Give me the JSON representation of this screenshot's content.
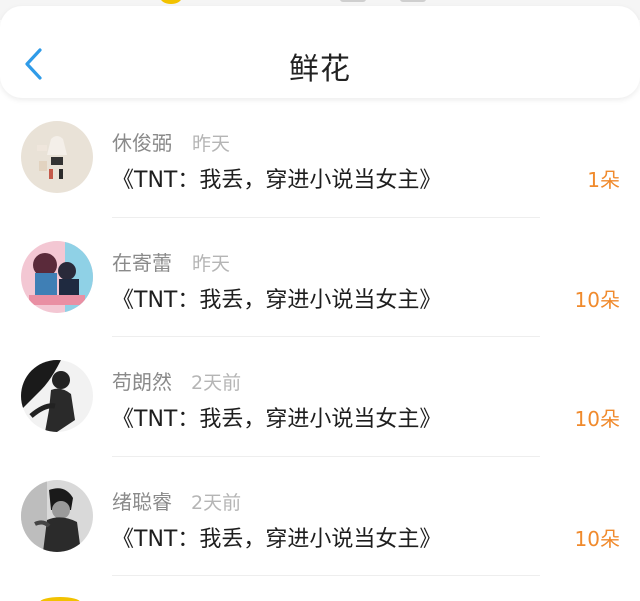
{
  "header": {
    "title": "鲜花",
    "back_icon": "chevron-left-icon",
    "accent": "#2f9be8"
  },
  "items": [
    {
      "name": "休俊弼",
      "time": "昨天",
      "book": "《TNT：我丢，穿进小说当女主》",
      "count": "1朵",
      "avatar": "fashion-avatar"
    },
    {
      "name": "在寄蕾",
      "time": "昨天",
      "book": "《TNT：我丢，穿进小说当女主》",
      "count": "10朵",
      "avatar": "anime-avatar"
    },
    {
      "name": "苟朗然",
      "time": "2天前",
      "book": "《TNT：我丢，穿进小说当女主》",
      "count": "10朵",
      "avatar": "silhouette-avatar"
    },
    {
      "name": "绪聪睿",
      "time": "2天前",
      "book": "《TNT：我丢，穿进小说当女主》",
      "count": "10朵",
      "avatar": "portrait-avatar"
    }
  ],
  "colors": {
    "count": "#f08a2c",
    "name": "#8a8a8a",
    "time": "#b5b5b5"
  }
}
